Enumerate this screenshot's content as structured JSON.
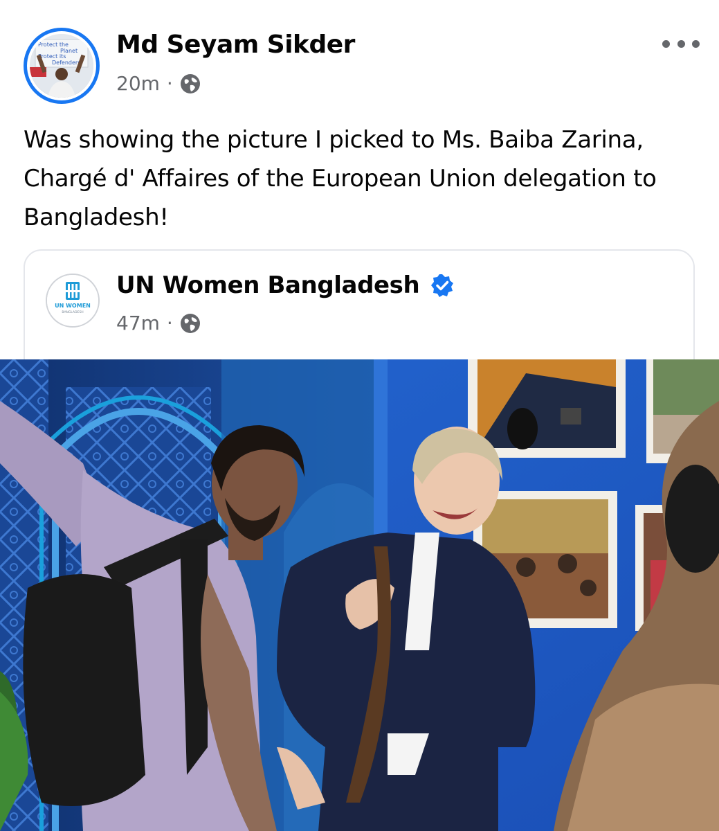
{
  "post": {
    "author": "Md Seyam Sikder",
    "time": "20m",
    "separator": "·",
    "privacy_icon": "globe-icon",
    "more_icon": "more-options-icon",
    "text": "Was showing the picture I picked to Ms. Baiba Zarina, Chargé d' Affaires of the European Union delegation to Bangladesh!",
    "avatar_sign": [
      "Protect the",
      "Planet",
      "Protect its",
      "Defenders"
    ]
  },
  "shared": {
    "author": "UN Women Bangladesh",
    "verified_icon": "verified-badge-icon",
    "time": "47m",
    "separator": "·",
    "privacy_icon": "globe-icon",
    "logo_text": "UN WOMEN",
    "logo_subtext": "BANGLADESH"
  },
  "colors": {
    "accent": "#1877f2",
    "meta_text": "#65676b",
    "border": "#e4e6eb"
  }
}
